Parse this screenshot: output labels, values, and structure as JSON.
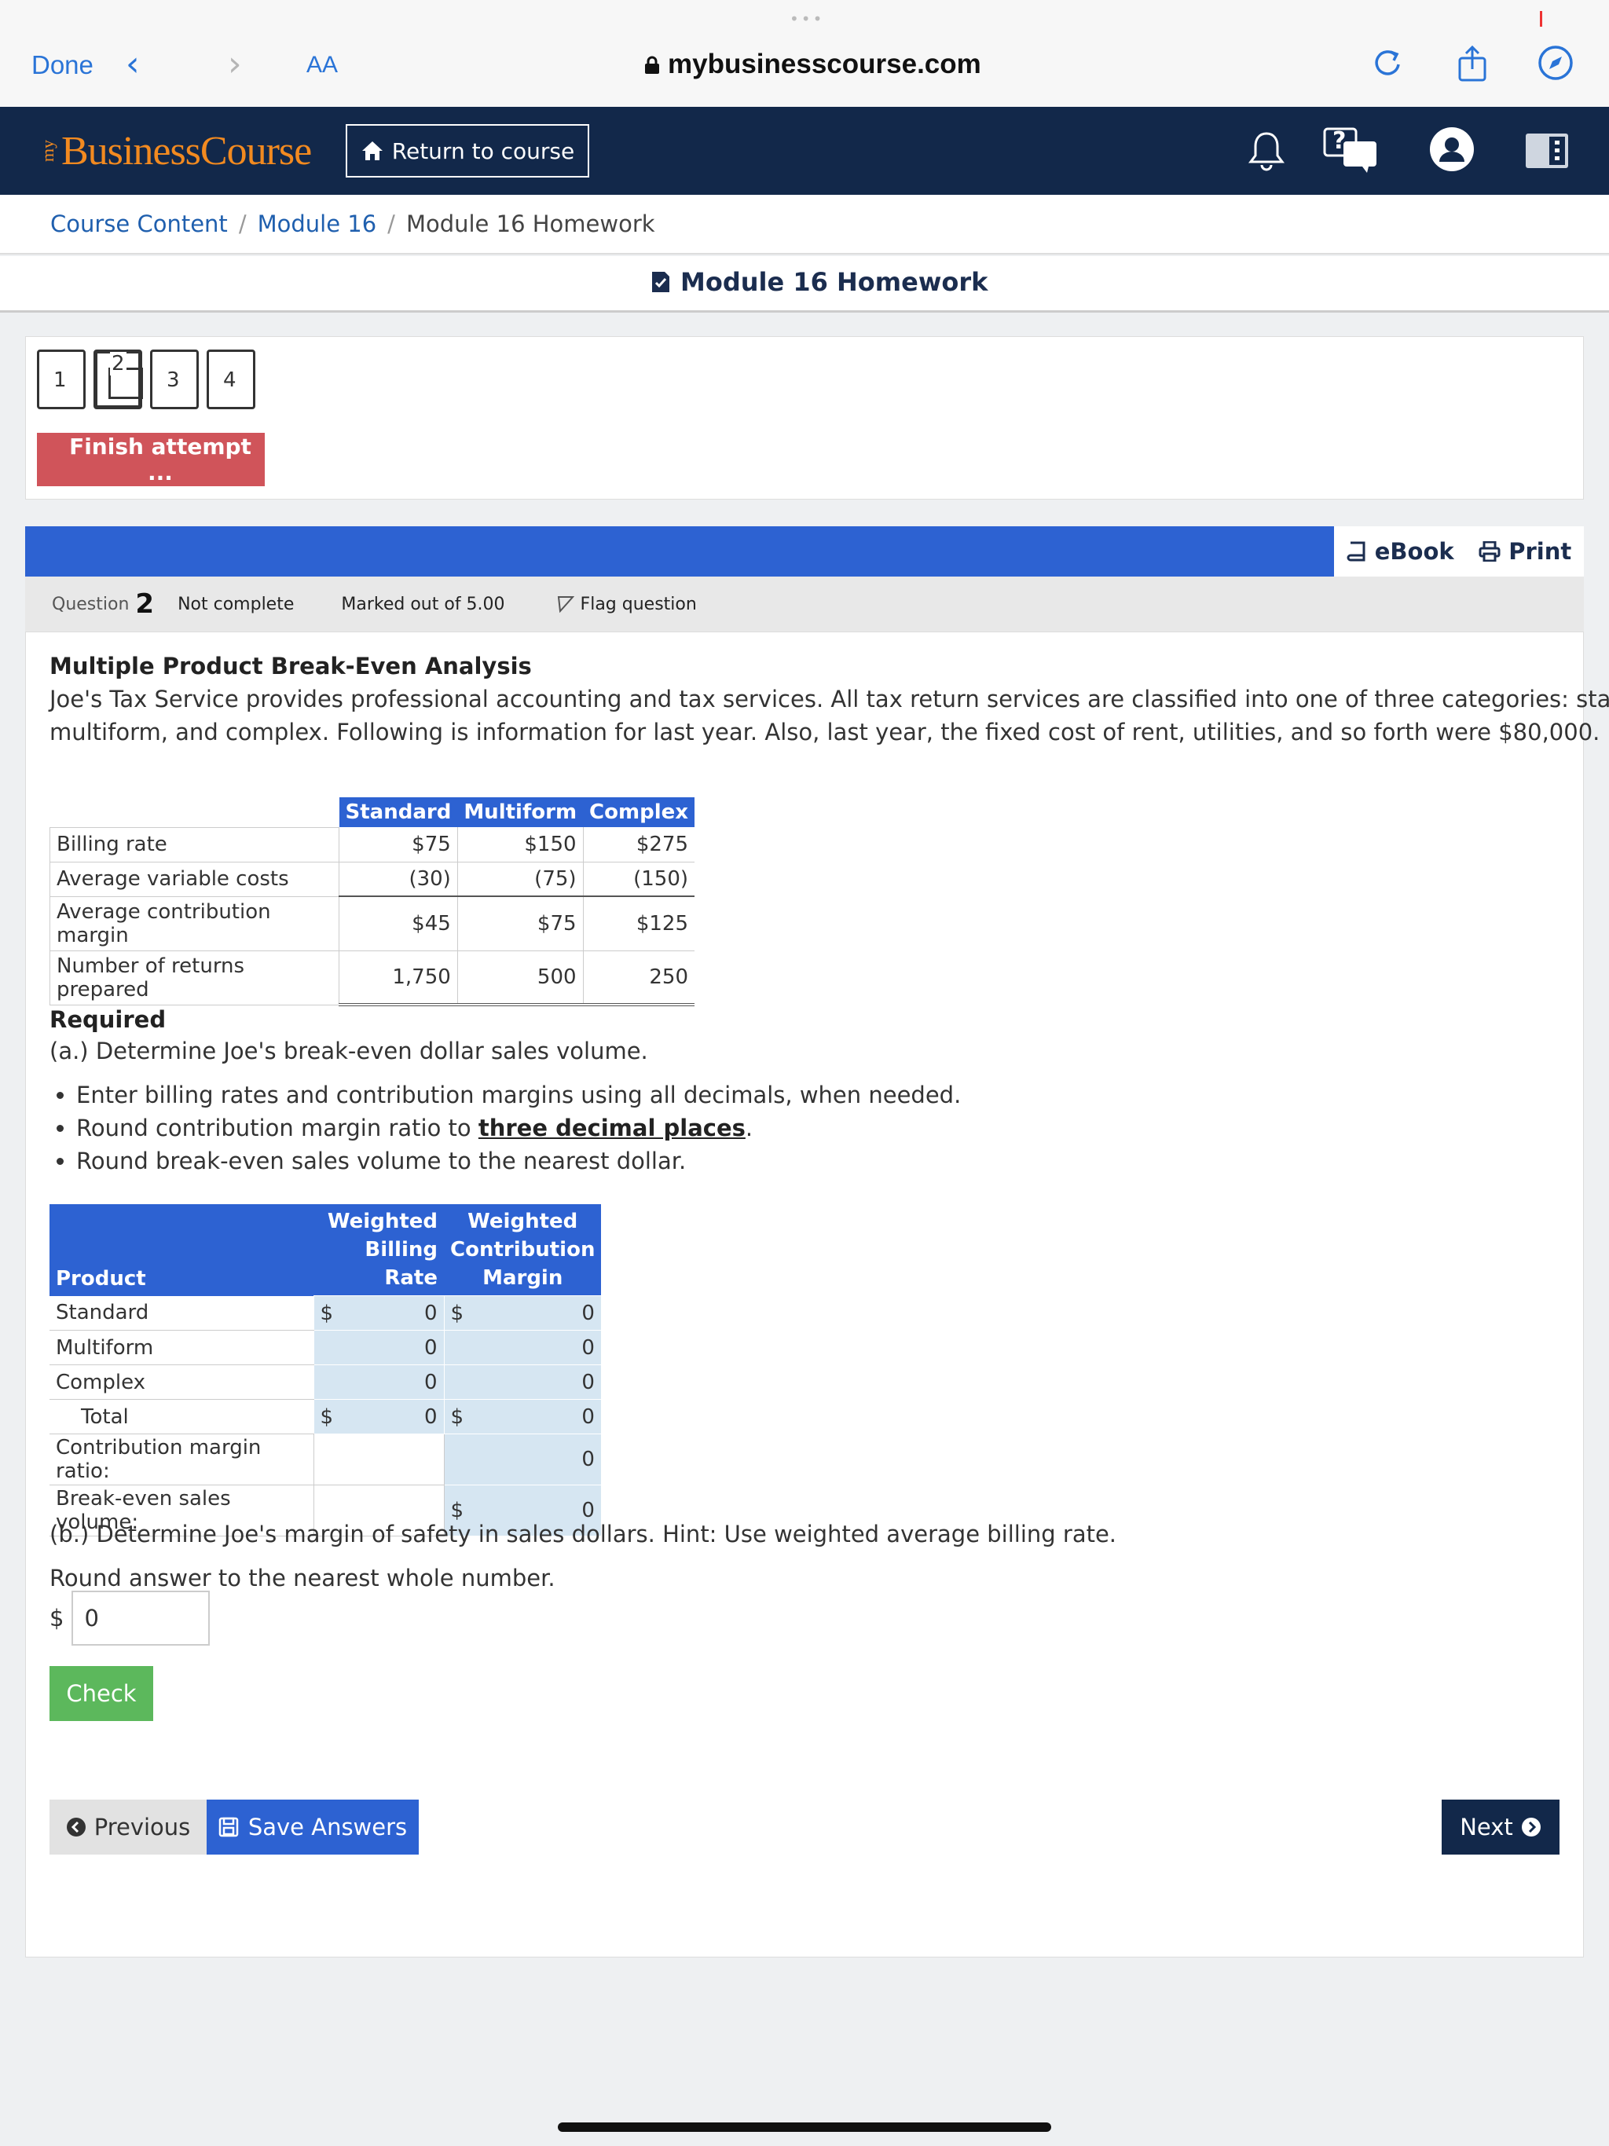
{
  "browser": {
    "done_label": "Done",
    "back_arrow": "‹",
    "forward_arrow": "›",
    "text_size_label": "AA",
    "url": "mybusinesscourse.com",
    "tab_dots": "•••"
  },
  "app": {
    "logo_prefix": "my",
    "logo_text": "BusinessCourse",
    "return_label": "Return to course",
    "help_mark": "?"
  },
  "breadcrumb": {
    "items": [
      "Course Content",
      "Module 16",
      "Module 16 Homework"
    ],
    "separator": "/"
  },
  "page_title": "Module 16 Homework",
  "quiz_nav": {
    "questions": [
      "1",
      "2",
      "3",
      "4"
    ],
    "current": "2",
    "finish_label": "Finish attempt ..."
  },
  "toolbar": {
    "ebook_label": "eBook",
    "print_label": "Print"
  },
  "question_info": {
    "question_label": "Question",
    "number": "2",
    "status": "Not complete",
    "marked": "Marked out of 5.00",
    "flag_label": "Flag question"
  },
  "problem": {
    "title": "Multiple Product Break-Even Analysis",
    "text_line1": "Joe's Tax Service provides professional accounting and tax services. All tax return services are classified into one of three categories: standard,",
    "text_line2": "multiform, and complex. Following is information for last year. Also, last year, the fixed cost of rent, utilities, and so forth were $80,000."
  },
  "data_table": {
    "columns": [
      "Standard",
      "Multiform",
      "Complex"
    ],
    "rows": [
      {
        "label": "Billing rate",
        "values": [
          "$75",
          "$150",
          "$275"
        ]
      },
      {
        "label": "Average variable costs",
        "values": [
          "(30)",
          "(75)",
          "(150)"
        ]
      },
      {
        "label": "Average contribution margin",
        "values": [
          "$45",
          "$75",
          "$125"
        ]
      },
      {
        "label": "Number of returns prepared",
        "values": [
          "1,750",
          "500",
          "250"
        ]
      }
    ]
  },
  "required": {
    "heading": "Required",
    "part_a": "(a.) Determine Joe's break-even dollar sales volume.",
    "bullet1": "Enter billing rates and contribution margins using all decimals, when needed.",
    "bullet2_pre": "Round contribution margin ratio to ",
    "bullet2_bold": "three decimal places",
    "bullet2_post": ".",
    "bullet3": "Round break-even sales volume to the nearest dollar."
  },
  "answer_table": {
    "col_product": "Product",
    "col_rate_l1": "Weighted",
    "col_rate_l2": "Billing Rate",
    "col_margin_l1": "Weighted",
    "col_margin_l2": "Contribution",
    "col_margin_l3": "Margin",
    "currency": "$",
    "rows": [
      {
        "label": "Standard",
        "rate": "0",
        "margin": "0"
      },
      {
        "label": "Multiform",
        "rate": "0",
        "margin": "0"
      },
      {
        "label": "Complex",
        "rate": "0",
        "margin": "0"
      },
      {
        "label": "Total",
        "rate": "0",
        "margin": "0"
      }
    ],
    "cm_ratio_label": "Contribution margin ratio:",
    "cm_ratio_value": "0",
    "breakeven_label": "Break-even sales volume:",
    "breakeven_value": "0"
  },
  "part_b": {
    "text": "(b.) Determine Joe's margin of safety in sales dollars. Hint: Use weighted average billing rate.",
    "round_note": "Round answer to the nearest whole number.",
    "currency": "$",
    "value": "0",
    "check_label": "Check"
  },
  "footer_nav": {
    "previous_label": "Previous",
    "save_label": "Save Answers",
    "next_label": "Next"
  },
  "colors": {
    "header_navy": "#12284a",
    "brand_orange": "#f28a20",
    "accent_blue": "#2d62d2",
    "finish_red": "#d0545a",
    "check_green": "#5cb85c",
    "link_blue": "#1f5fae",
    "input_blue": "#d6e6f2"
  },
  "icons": [
    "lock-icon",
    "reload-icon",
    "share-icon",
    "compass-icon",
    "home-icon",
    "bell-icon",
    "chat-help-icon",
    "user-avatar-icon",
    "sidebar-toggle-icon",
    "checked-doc-icon",
    "book-icon",
    "printer-icon",
    "flag-icon",
    "chevron-left-circle-icon",
    "save-disk-icon",
    "chevron-right-circle-icon"
  ]
}
